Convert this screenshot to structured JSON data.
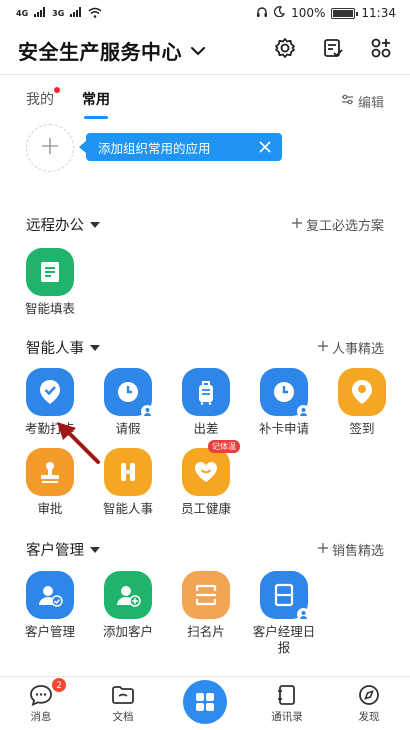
{
  "status_bar": {
    "network_left": "4G",
    "network_right": "3G",
    "battery": "100%",
    "time": "11:34"
  },
  "header": {
    "title": "安全生产服务中心"
  },
  "tabs": {
    "mine": "我的",
    "common": "常用",
    "edit": "编辑"
  },
  "tip": {
    "text": "添加组织常用的应用"
  },
  "sections": {
    "remote": {
      "title": "远程办公",
      "action": "复工必选方案"
    },
    "hr": {
      "title": "智能人事",
      "action": "人事精选"
    },
    "crm": {
      "title": "客户管理",
      "action": "销售精选"
    }
  },
  "apps": {
    "smart_form": "智能填表",
    "attendance": "考勤打卡",
    "leave": "请假",
    "trip": "出差",
    "makeup": "补卡申请",
    "checkin": "签到",
    "approval": "审批",
    "smart_hr": "智能人事",
    "health": "员工健康",
    "health_tag": "记体温",
    "customer_mgmt": "客户管理",
    "add_customer": "添加客户",
    "scan_card": "扫名片",
    "manager_daily": "客户经理日报"
  },
  "bottom_nav": {
    "messages": "消息",
    "messages_count": "2",
    "docs": "文档",
    "contacts": "通讯录",
    "discover": "发现"
  },
  "colors": {
    "accent": "#1890ff",
    "blue_icon": "#2e87e8",
    "green_icon": "#1fb36b",
    "orange_icon": "#f5a623",
    "badge_red": "#e8413d"
  }
}
